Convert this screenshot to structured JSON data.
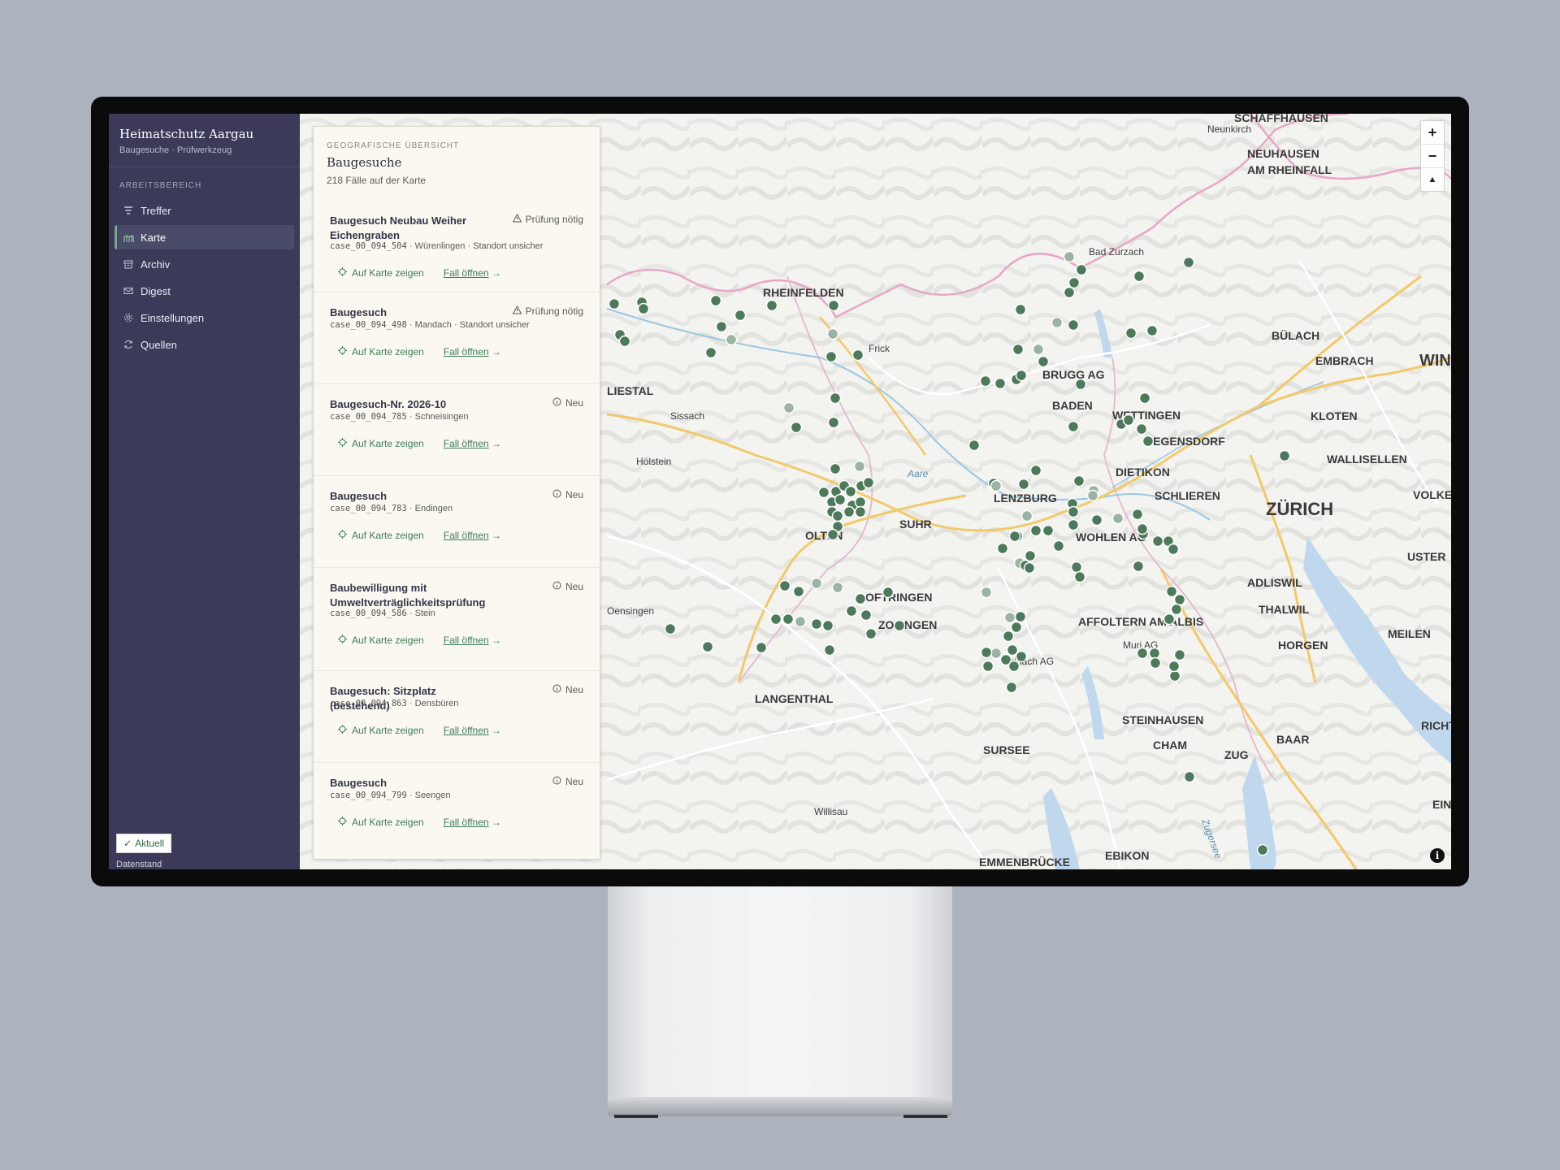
{
  "app": {
    "title": "Heimatschutz Aargau",
    "subtitle": "Baugesuche · Prüfwerkzeug"
  },
  "sidebar": {
    "section_label": "ARBEITSBEREICH",
    "items": [
      {
        "label": "Treffer",
        "icon": "list-filter-icon",
        "active": false
      },
      {
        "label": "Karte",
        "icon": "map-icon",
        "active": true
      },
      {
        "label": "Archiv",
        "icon": "archive-icon",
        "active": false
      },
      {
        "label": "Digest",
        "icon": "mail-icon",
        "active": false
      },
      {
        "label": "Einstellungen",
        "icon": "gear-icon",
        "active": false
      },
      {
        "label": "Quellen",
        "icon": "refresh-icon",
        "active": false
      }
    ],
    "status": {
      "label": "Aktuell",
      "icon": "check-icon",
      "footer": "Datenstand"
    }
  },
  "panel": {
    "eyebrow": "GEOGRAFISCHE ÜBERSICHT",
    "title": "Baugesuche",
    "count": "218 Fälle auf der Karte",
    "action_map": "Auf Karte zeigen",
    "action_open": "Fall öffnen",
    "cases": [
      {
        "title": "Baugesuch Neubau Weiher Eichengraben",
        "id": "case_00_094_504",
        "meta": " · Würenlingen · Standort unsicher",
        "badge": "Prüfung nötig",
        "badge_icon": "warning-icon"
      },
      {
        "title": "Baugesuch",
        "id": "case_00_094_498",
        "meta": " · Mandach · Standort unsicher",
        "badge": "Prüfung nötig",
        "badge_icon": "warning-icon"
      },
      {
        "title": "Baugesuch-Nr. 2026-10",
        "id": "case_00_094_785",
        "meta": " · Schneisingen",
        "badge": "Neu",
        "badge_icon": "info-icon"
      },
      {
        "title": "Baugesuch",
        "id": "case_00_094_783",
        "meta": " · Endingen",
        "badge": "Neu",
        "badge_icon": "info-icon"
      },
      {
        "title": "Baubewilligung mit Umweltverträglichkeitsprüfung",
        "id": "case_00_094_586",
        "meta": " · Stein",
        "badge": "Neu",
        "badge_icon": "info-icon"
      },
      {
        "title": "Baugesuch: Sitzplatz (bestehend)",
        "id": "case_00_094_863",
        "meta": " · Densbüren",
        "badge": "Neu",
        "badge_icon": "info-icon"
      },
      {
        "title": "Baugesuch",
        "id": "case_00_094_799",
        "meta": " · Seengen",
        "badge": "Neu",
        "badge_icon": "info-icon"
      }
    ]
  },
  "map": {
    "zoom_in": "+",
    "zoom_out": "−",
    "compass": "▲",
    "info": "i",
    "labels_major": [
      "SCHAFFHAUSEN",
      "NEUHAUSEN",
      "AM RHEINFALL",
      "RHEINFELDEN",
      "BÜLACH",
      "EMBRACH",
      "WIN",
      "LIESTAL",
      "BRUGG AG",
      "BADEN",
      "WETTINGEN",
      "REGENSDORF",
      "KLOTEN",
      "DIETIKON",
      "WALLISELLEN",
      "LENZBURG",
      "SCHLIEREN",
      "VOLKETSW",
      "SUHR",
      "ZÜRICH",
      "OLTEN",
      "WOHLEN AG",
      "USTER",
      "OFTRINGEN",
      "ZOFINGEN",
      "ADLISWIL",
      "THALWIL",
      "AFFOLTERN AM ALBIS",
      "MEILEN",
      "HORGEN",
      "LANGENTHAL",
      "STEINHAUSEN",
      "CHAM",
      "BAAR",
      "ZUG",
      "RICHTERS",
      "SURSEE",
      "EMMENBRÜCKE",
      "EBIKON",
      "EINS"
    ],
    "labels_minor": [
      "Neunkirch",
      "Bad Zurzach",
      "Frick",
      "Sissach",
      "Hölstein",
      "Aare",
      "Muri AG",
      "Reinach AG",
      "Willisau",
      "Zugersee",
      "Oensingen"
    ],
    "marker_color": "#4e7a5c",
    "marker_color_light": "#9bb3a2"
  }
}
